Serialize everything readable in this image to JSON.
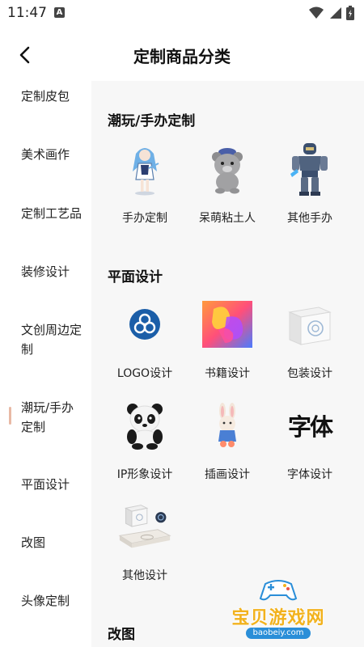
{
  "status": {
    "time": "11:47",
    "a_badge": "A"
  },
  "header": {
    "title": "定制商品分类"
  },
  "sidebar": {
    "items": [
      {
        "label": "定制皮包"
      },
      {
        "label": "美术画作"
      },
      {
        "label": "定制工艺品"
      },
      {
        "label": "装修设计"
      },
      {
        "label": "文创周边定制"
      },
      {
        "label": "潮玩/手办定制",
        "active": true
      },
      {
        "label": "平面设计"
      },
      {
        "label": "改图"
      },
      {
        "label": "头像定制"
      }
    ],
    "accent": "#e8b9a5"
  },
  "sections": [
    {
      "title": "潮玩/手办定制",
      "items": [
        {
          "label": "手办定制",
          "icon": "anime-figure-icon"
        },
        {
          "label": "呆萌粘土人",
          "icon": "clay-bear-icon"
        },
        {
          "label": "其他手办",
          "icon": "robot-figure-icon"
        }
      ]
    },
    {
      "title": "平面设计",
      "items": [
        {
          "label": "LOGO设计",
          "icon": "logo-knot-icon"
        },
        {
          "label": "书籍设计",
          "icon": "book-cover-icon"
        },
        {
          "label": "包装设计",
          "icon": "package-box-icon"
        },
        {
          "label": "IP形象设计",
          "icon": "panda-icon"
        },
        {
          "label": "插画设计",
          "icon": "bunny-icon"
        },
        {
          "label": "字体设计",
          "icon": "font-sample-icon",
          "glyph": "字体"
        },
        {
          "label": "其他设计",
          "icon": "book-mockup-icon"
        }
      ]
    },
    {
      "title": "改图",
      "items": []
    }
  ],
  "watermark": {
    "text": "宝贝游戏网",
    "url": "baobeiy.com"
  }
}
